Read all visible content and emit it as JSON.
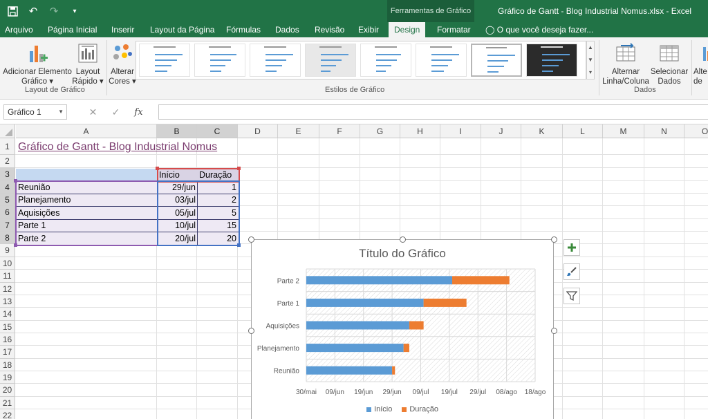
{
  "titlebar": {
    "context_group": "Ferramentas de Gráfico",
    "window_title": "Gráfico de Gantt - Blog Industrial Nomus.xlsx - Excel"
  },
  "tabs": [
    "Arquivo",
    "Página Inicial",
    "Inserir",
    "Layout da Página",
    "Fórmulas",
    "Dados",
    "Revisão",
    "Exibir",
    "Design",
    "Formatar"
  ],
  "active_tab": "Design",
  "tell_me": "O que você deseja fazer...",
  "ribbon": {
    "add_element": [
      "Adicionar Elemento",
      "Gráfico"
    ],
    "quick_layout": [
      "Layout",
      "Rápido"
    ],
    "change_colors": [
      "Alterar",
      "Cores"
    ],
    "switch_row_col": [
      "Alternar",
      "Linha/Coluna"
    ],
    "select_data": [
      "Selecionar",
      "Dados"
    ],
    "change_type": [
      "Alte",
      "de"
    ],
    "group_layout": "Layout de Gráfico",
    "group_styles": "Estilos de Gráfico",
    "group_data": "Dados"
  },
  "formula_bar": {
    "name_box": "Gráfico 1",
    "fx": "fx",
    "value": ""
  },
  "columns": [
    "A",
    "B",
    "C",
    "D",
    "E",
    "F",
    "G",
    "H",
    "I",
    "J",
    "K",
    "L",
    "M",
    "N",
    "O"
  ],
  "rows": [
    "1",
    "2",
    "3",
    "4",
    "5",
    "6",
    "7",
    "8",
    "9",
    "10",
    "11",
    "12",
    "13",
    "14",
    "15",
    "16",
    "17",
    "18",
    "19",
    "20",
    "21",
    "22"
  ],
  "sheet": {
    "title": "Gráfico de Gantt - Blog Industrial Nomus",
    "header_inicio": "Início",
    "header_duracao": "Duração",
    "tasks": [
      {
        "name": "Reunião",
        "start": "29/jun",
        "duration": "1"
      },
      {
        "name": "Planejamento",
        "start": "03/jul",
        "duration": "2"
      },
      {
        "name": "Aquisições",
        "start": "05/jul",
        "duration": "5"
      },
      {
        "name": "Parte 1",
        "start": "10/jul",
        "duration": "15"
      },
      {
        "name": "Parte 2",
        "start": "20/jul",
        "duration": "20"
      }
    ]
  },
  "chart_data": {
    "type": "bar",
    "orientation": "horizontal",
    "stacked": true,
    "title": "Título do Gráfico",
    "categories": [
      "Reunião",
      "Planejamento",
      "Aquisições",
      "Parte 1",
      "Parte 2"
    ],
    "series": [
      {
        "name": "Início",
        "values": [
          "2017-06-29",
          "2017-07-03",
          "2017-07-05",
          "2017-07-10",
          "2017-07-20"
        ],
        "color": "#5b9bd5"
      },
      {
        "name": "Duração",
        "values": [
          1,
          2,
          5,
          15,
          20
        ],
        "color": "#ed7d31"
      }
    ],
    "x_ticks": [
      "30/mai",
      "09/jun",
      "19/jun",
      "29/jun",
      "09/jul",
      "19/jul",
      "29/jul",
      "08/ago",
      "18/ago"
    ],
    "xlim": [
      "2017-05-30",
      "2017-08-18"
    ],
    "legend_position": "bottom"
  }
}
